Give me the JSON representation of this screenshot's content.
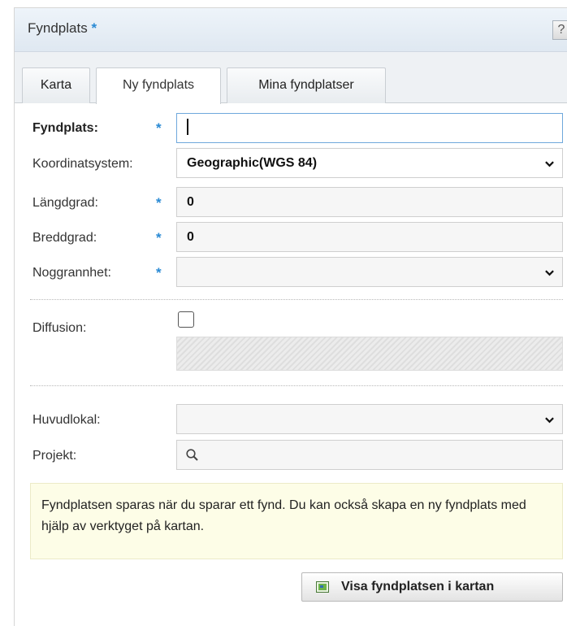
{
  "header": {
    "title": "Fyndplats",
    "required_mark": "*",
    "help_label": "?"
  },
  "tabs": [
    {
      "label": "Karta"
    },
    {
      "label": "Ny fyndplats"
    },
    {
      "label": "Mina fyndplatser"
    }
  ],
  "form": {
    "fyndplats": {
      "label": "Fyndplats:",
      "value": "",
      "required": "*"
    },
    "koordinatsystem": {
      "label": "Koordinatsystem:",
      "selected": "Geographic(WGS 84)"
    },
    "langdgrad": {
      "label": "Längdgrad:",
      "value": "0",
      "required": "*"
    },
    "breddgrad": {
      "label": "Breddgrad:",
      "value": "0",
      "required": "*"
    },
    "noggrannhet": {
      "label": "Noggrannhet:",
      "selected": "",
      "required": "*"
    },
    "diffusion": {
      "label": "Diffusion:",
      "checked": false
    },
    "huvudlokal": {
      "label": "Huvudlokal:",
      "selected": ""
    },
    "projekt": {
      "label": "Projekt:",
      "value": ""
    }
  },
  "notice": {
    "text": "Fyndplatsen sparas när du sparar ett fynd. Du kan också skapa en ny fyndplats med hjälp av verktyget på kartan."
  },
  "actions": {
    "show_on_map_label": "Visa fyndplatsen i kartan"
  },
  "colors": {
    "accent": "#2a8ad4",
    "notice_bg": "#fdfde7"
  },
  "icons": [
    "help-icon",
    "chevron-down-icon",
    "search-icon",
    "map-icon"
  ]
}
